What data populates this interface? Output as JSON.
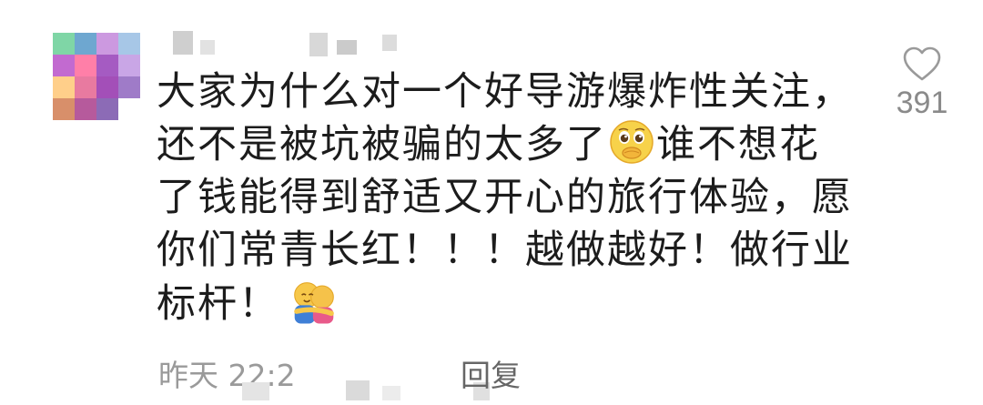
{
  "comment": {
    "avatar": {
      "colors": [
        "#7fd6a6",
        "#6ea7d0",
        "#cc99e0",
        "#a7c7e7",
        "#c26ad0",
        "#ff7fa8",
        "#a55bc2",
        "#c9a6e6",
        "#ffcf8a",
        "#e87aa0",
        "#a34fb8",
        "#9f7bc8",
        "#d88f6a",
        "#b65a9c",
        "#8c6bb6",
        "#ffffff"
      ]
    },
    "body_lines": [
      "大家为什么对一个好导游爆炸性关注，",
      "还不是被坑被骗的太多了",
      "谁不想花",
      "了钱能得到舒适又开心的旅行体验，愿",
      "你们常青长红！！！越做越好！做行业",
      "标杆！"
    ],
    "emoji_1": "pleading-face-icon",
    "emoji_2": "people-hugging-icon",
    "likes": {
      "icon": "heart-outline-icon",
      "count": "391"
    },
    "meta": {
      "time_prefix": "昨天 22:2",
      "reply_label": "回复"
    },
    "colors": {
      "text": "#1c1c1c",
      "muted": "#9a9a9a",
      "like": "#8a8a8a"
    }
  }
}
